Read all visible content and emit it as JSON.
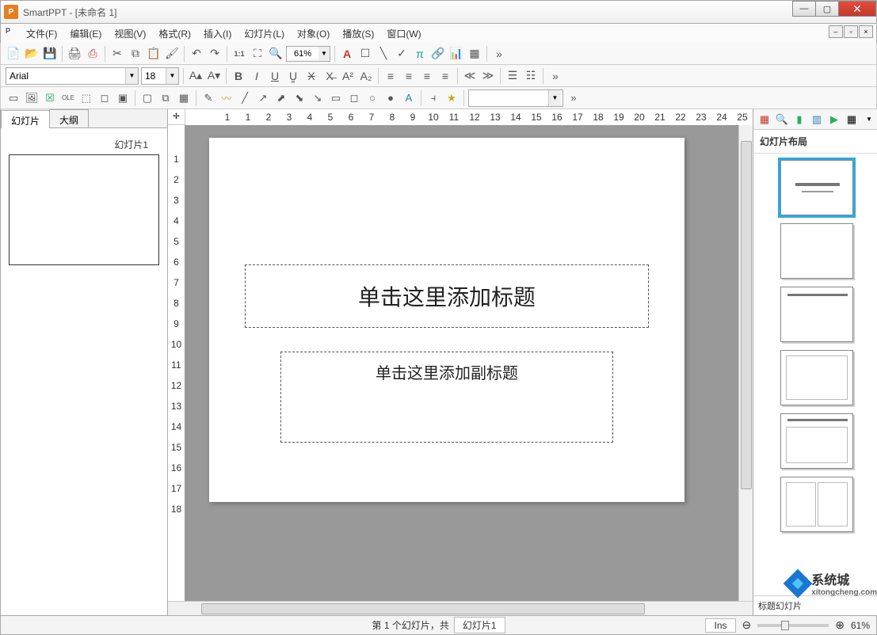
{
  "window": {
    "app": "SmartPPT",
    "doc": "[未命名 1]"
  },
  "menus": [
    "文件(F)",
    "编辑(E)",
    "视图(V)",
    "格式(R)",
    "插入(I)",
    "幻灯片(L)",
    "对象(O)",
    "播放(S)",
    "窗口(W)"
  ],
  "zoom": "61%",
  "font": {
    "name": "Arial",
    "size": "18"
  },
  "tabs": {
    "slides": "幻灯片",
    "outline": "大纲"
  },
  "thumb_label": "幻灯片1",
  "placeholders": {
    "title": "单击这里添加标题",
    "subtitle": "单击这里添加副标题"
  },
  "right": {
    "title": "幻灯片布局",
    "footer": "标题幻灯片"
  },
  "status": {
    "center": "第 1 个幻灯片，共",
    "field": "幻灯片1",
    "ins": "Ins",
    "zoom": "61%"
  },
  "ruler_h": [
    "1",
    "1",
    "2",
    "3",
    "4",
    "5",
    "6",
    "7",
    "8",
    "9",
    "10",
    "11",
    "12",
    "13",
    "14",
    "15",
    "16",
    "17",
    "18",
    "19",
    "20",
    "21",
    "22",
    "23",
    "24",
    "25"
  ],
  "ruler_v": [
    "1",
    "2",
    "3",
    "4",
    "5",
    "6",
    "7",
    "8",
    "9",
    "10",
    "11",
    "12",
    "13",
    "14",
    "15",
    "16",
    "17",
    "18"
  ],
  "watermark": {
    "text": "系统城",
    "url": "xitongcheng.com"
  }
}
